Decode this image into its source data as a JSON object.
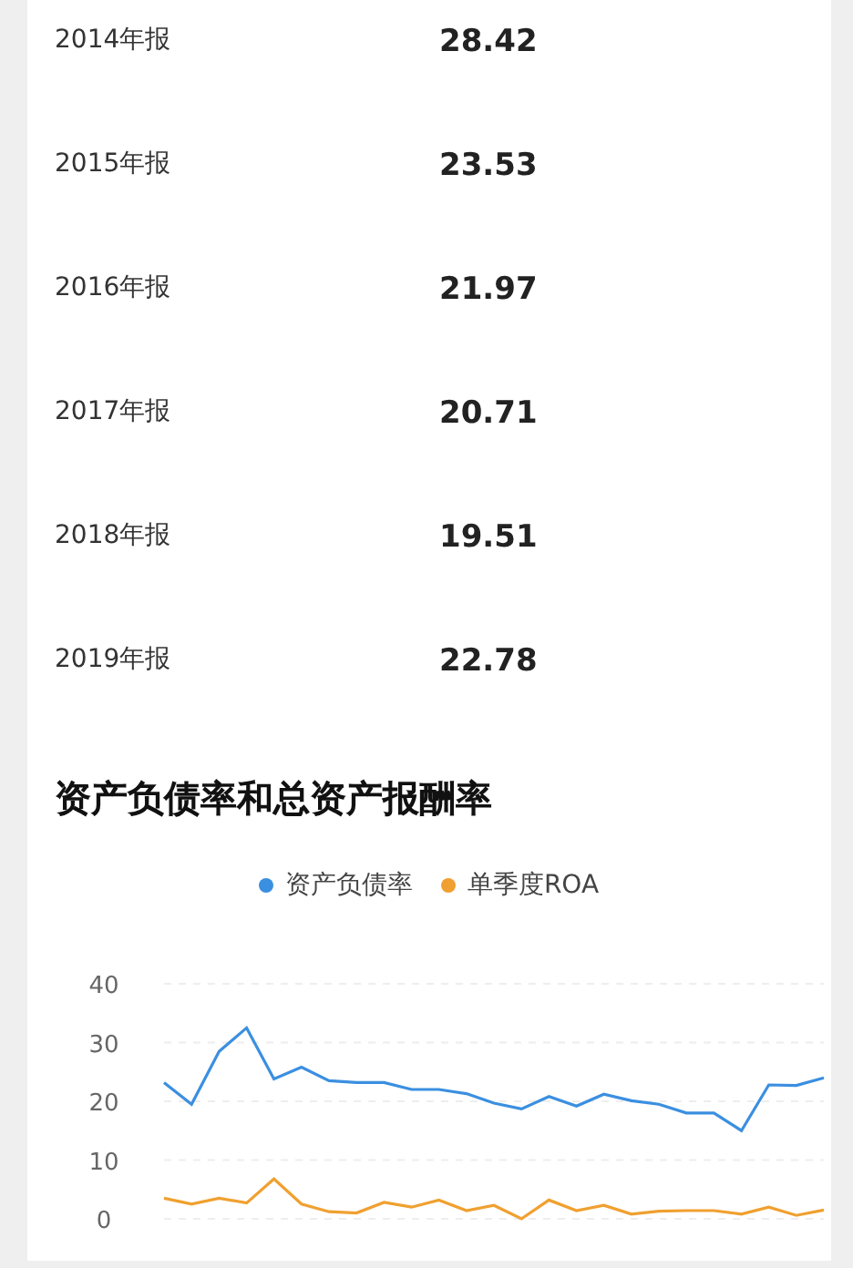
{
  "rows": [
    {
      "label": "2014年报",
      "value": "28.42"
    },
    {
      "label": "2015年报",
      "value": "23.53"
    },
    {
      "label": "2016年报",
      "value": "21.97"
    },
    {
      "label": "2017年报",
      "value": "20.71"
    },
    {
      "label": "2018年报",
      "value": "19.51"
    },
    {
      "label": "2019年报",
      "value": "22.78"
    }
  ],
  "section_title": "资产负债率和总资产报酬率",
  "chart_data": {
    "type": "line",
    "grid": true,
    "ylim": [
      0,
      40
    ],
    "yticks": [
      0,
      10,
      20,
      30,
      40
    ],
    "series": [
      {
        "name": "资产负债率",
        "color": "#3b8fe0",
        "values": [
          23.2,
          19.5,
          28.5,
          32.5,
          23.8,
          25.8,
          23.5,
          23.2,
          23.2,
          22,
          22,
          21.3,
          19.7,
          18.7,
          20.8,
          19.2,
          21.2,
          20.1,
          19.5,
          18,
          18,
          15,
          22.8,
          22.7,
          24
        ]
      },
      {
        "name": "单季度ROA",
        "color": "#f0a030",
        "values": [
          3.5,
          2.5,
          3.5,
          2.7,
          6.8,
          2.5,
          1.2,
          1.0,
          2.8,
          2.0,
          3.2,
          1.4,
          2.3,
          0,
          3.2,
          1.4,
          2.3,
          0.8,
          1.3,
          1.4,
          1.4,
          0.8,
          2.0,
          0.6,
          1.5
        ]
      }
    ]
  }
}
